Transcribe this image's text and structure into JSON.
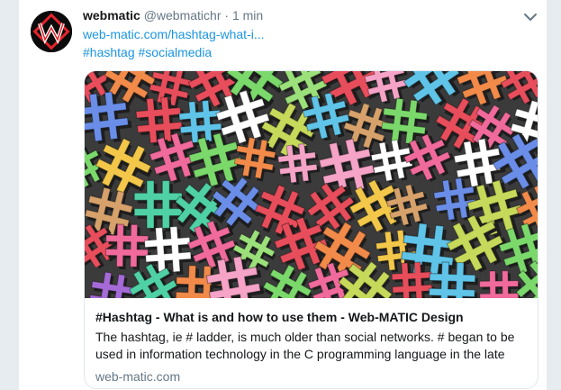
{
  "tweet": {
    "author_name": "webmatic",
    "author_handle": "@webmatichr",
    "separator": "·",
    "time": "1 min",
    "link": "web-matic.com/hashtag-what-i...",
    "hashtags": [
      "#hashtag",
      "#socialmedia"
    ]
  },
  "card": {
    "title": "#Hashtag - What is and how to use them - Web-MATIC Design",
    "description": "The hashtag, ie # ladder, is much older than social networks. # began to be used in information technology in the C programming language in the late",
    "domain": "web-matic.com"
  },
  "colors": {
    "link": "#1b95e0",
    "muted": "#657786",
    "text": "#14171a",
    "logo_red": "#e3232a"
  },
  "icons": {
    "avatar": "webmatic-logo-icon",
    "menu": "chevron-down-icon"
  }
}
